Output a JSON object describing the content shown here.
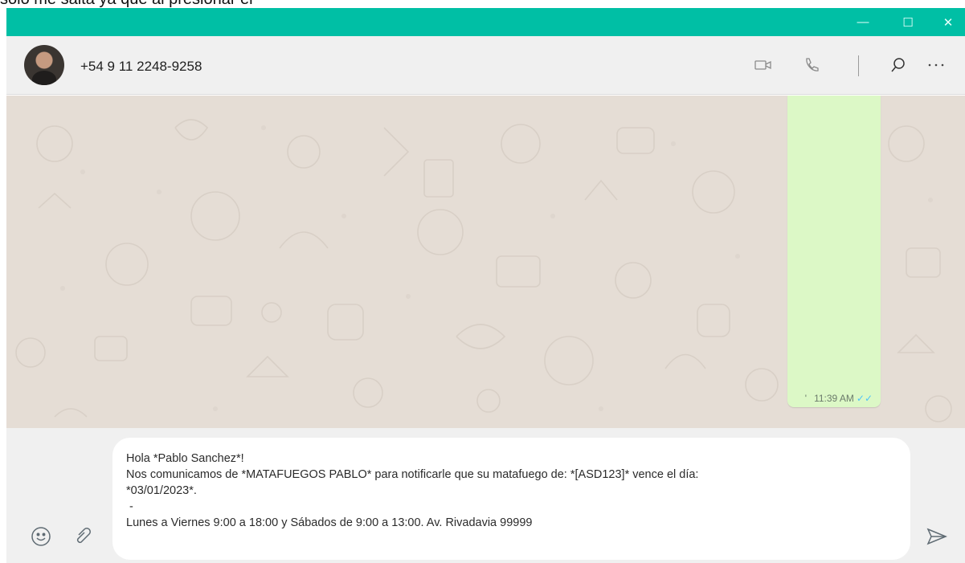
{
  "overlay_caption": "solo me salta ya que al presionar el ",
  "window_controls": {
    "minimize": "—",
    "maximize": "☐",
    "close": "✕"
  },
  "contact": {
    "name": "+54 9 11 2248-9258"
  },
  "header_icons": [
    "video-call-icon",
    "voice-call-icon",
    "search-icon",
    "more-options-icon"
  ],
  "message": {
    "marker": "'",
    "time": "11:39 AM",
    "status": "✓✓"
  },
  "composer": {
    "lines": [
      "Hola *Pablo Sanchez*!",
      "Nos comunicamos de *MATAFUEGOS PABLO* para notificarle que su matafuego de: *[ASD123]* vence el día:",
      "*03/01/2023*.",
      " -",
      "Lunes a Viernes 9:00 a 18:00 y Sábados de 9:00 a 13:00. Av. Rivadavia 99999"
    ]
  },
  "colors": {
    "accent": "#00bfa5",
    "chat_bg": "#e5ddd5",
    "bubble": "#dcf8c6",
    "read_tick": "#4fc3f7"
  }
}
